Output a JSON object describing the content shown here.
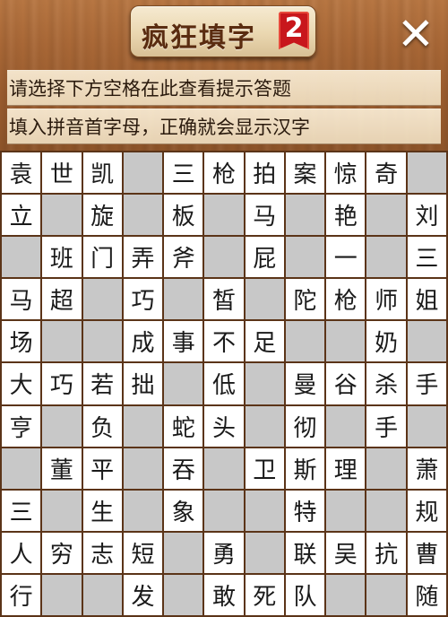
{
  "header": {
    "title": "疯狂填字",
    "level": "2",
    "close_label": "✕"
  },
  "hints": {
    "line1": "请选择下方空格在此查看提示答题",
    "line2": "填入拼音首字母，正确就会显示汉字"
  },
  "grid": {
    "rows": [
      [
        "袁",
        "世",
        "凯",
        "",
        "三",
        "枪",
        "拍",
        "案",
        "惊",
        "奇",
        ""
      ],
      [
        "立",
        "",
        "旋",
        "",
        "板",
        "",
        "马",
        "",
        "艳",
        "",
        "刘"
      ],
      [
        "",
        "班",
        "门",
        "弄",
        "斧",
        "",
        "屁",
        "",
        "一",
        "",
        "三"
      ],
      [
        "马",
        "超",
        "",
        "巧",
        "",
        "皙",
        "",
        "陀",
        "枪",
        "师",
        "姐"
      ],
      [
        "场",
        "",
        "",
        "成",
        "事",
        "不",
        "足",
        "",
        "",
        "奶",
        ""
      ],
      [
        "大",
        "巧",
        "若",
        "拙",
        "",
        "低",
        "",
        "曼",
        "谷",
        "杀",
        "手"
      ],
      [
        "亨",
        "",
        "负",
        "",
        "蛇",
        "头",
        "",
        "彻",
        "",
        "手",
        ""
      ],
      [
        "",
        "董",
        "平",
        "",
        "吞",
        "",
        "卫",
        "斯",
        "理",
        "",
        "萧"
      ],
      [
        "三",
        "",
        "生",
        "",
        "象",
        "",
        "",
        "特",
        "",
        "",
        "规"
      ],
      [
        "人",
        "穷",
        "志",
        "短",
        "",
        "勇",
        "",
        "联",
        "吴",
        "抗",
        "曹"
      ],
      [
        "行",
        "",
        "",
        "发",
        "",
        "敢",
        "死",
        "队",
        "",
        "",
        "随"
      ]
    ],
    "blocked": [
      [
        false,
        false,
        false,
        true,
        false,
        false,
        false,
        false,
        false,
        false,
        true
      ],
      [
        false,
        true,
        false,
        true,
        false,
        true,
        false,
        true,
        false,
        true,
        false
      ],
      [
        true,
        false,
        false,
        false,
        false,
        true,
        false,
        true,
        false,
        true,
        false
      ],
      [
        false,
        false,
        true,
        false,
        true,
        false,
        true,
        false,
        false,
        false,
        false
      ],
      [
        false,
        true,
        true,
        false,
        false,
        false,
        false,
        true,
        true,
        false,
        true
      ],
      [
        false,
        false,
        false,
        false,
        true,
        false,
        true,
        false,
        false,
        false,
        false
      ],
      [
        false,
        true,
        false,
        true,
        false,
        false,
        true,
        false,
        true,
        false,
        true
      ],
      [
        true,
        false,
        false,
        true,
        false,
        true,
        false,
        false,
        false,
        true,
        false
      ],
      [
        false,
        true,
        false,
        true,
        false,
        true,
        true,
        false,
        true,
        true,
        false
      ],
      [
        false,
        false,
        false,
        false,
        true,
        false,
        true,
        false,
        false,
        false,
        false
      ],
      [
        false,
        true,
        true,
        false,
        true,
        false,
        false,
        false,
        true,
        true,
        false
      ]
    ]
  }
}
